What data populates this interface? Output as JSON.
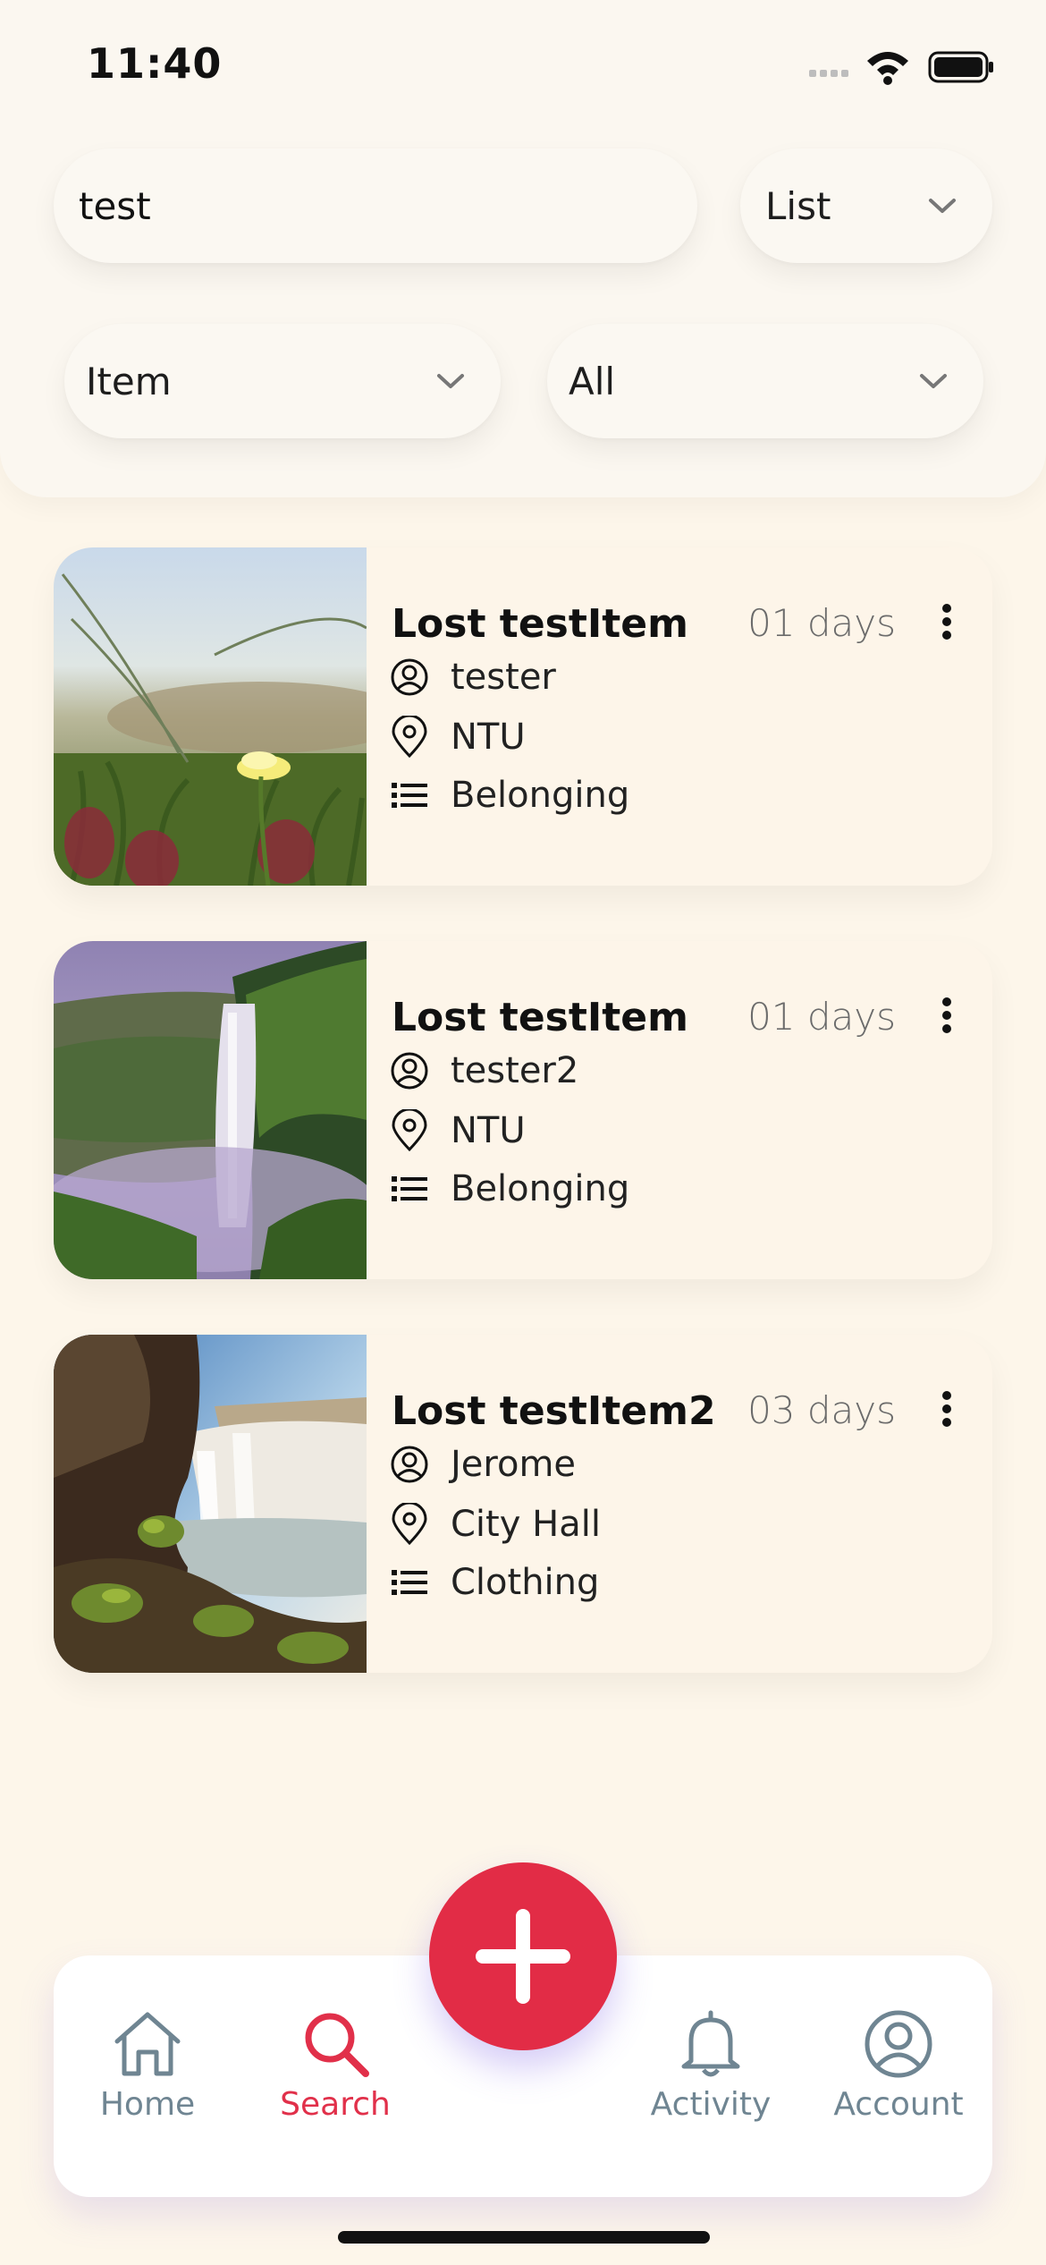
{
  "status_bar": {
    "time": "11:40"
  },
  "search": {
    "query": "test"
  },
  "filters": {
    "view": "List",
    "type": "Item",
    "scope": "All"
  },
  "results": [
    {
      "title": "Lost testItem",
      "age": "01 days",
      "user": "tester",
      "location": "NTU",
      "category": "Belonging",
      "image": "flower-photo"
    },
    {
      "title": "Lost testItem",
      "age": "01 days",
      "user": "tester2",
      "location": "NTU",
      "category": "Belonging",
      "image": "waterfall-photo"
    },
    {
      "title": "Lost testItem2",
      "age": "03 days",
      "user": "Jerome",
      "location": "City Hall",
      "category": "Clothing",
      "image": "waterfall-river-photo"
    }
  ],
  "nav": {
    "home": "Home",
    "search": "Search",
    "activity": "Activity",
    "account": "Account"
  },
  "colors": {
    "accent": "#e22c46",
    "inactive": "#6f8592",
    "background": "#fdf6ea"
  },
  "icons": {
    "fab": "plus-icon",
    "home": "home-icon",
    "search": "search-icon",
    "activity": "bell-icon",
    "account": "account-icon"
  }
}
